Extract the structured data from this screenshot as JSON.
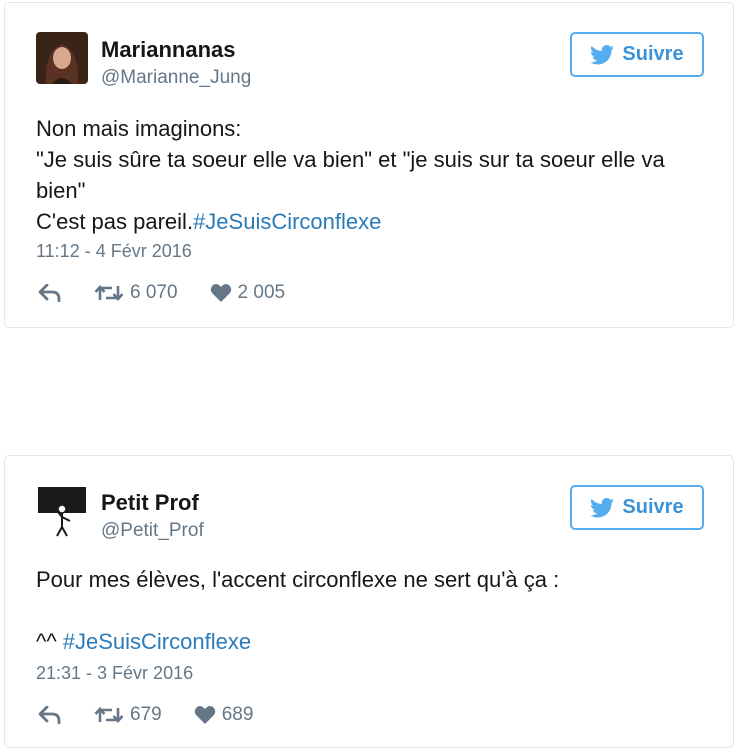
{
  "colors": {
    "accent": "#55acee",
    "link": "#2b7bb9",
    "muted": "#657786",
    "text": "#14171a",
    "border": "#e1e8ed"
  },
  "icons": {
    "follow": "twitter-bird-icon",
    "reply": "reply-arrow-icon",
    "retweet": "retweet-icon",
    "like": "heart-icon"
  },
  "tweets": [
    {
      "display_name": "Mariannanas",
      "handle": "@Marianne_Jung",
      "follow_label": "Suivre",
      "lines": [
        "Non mais imaginons:",
        "\"Je suis sûre ta soeur elle va bien\" et \"je suis sur ta soeur elle va",
        "bien\""
      ],
      "last_line_text": "C'est pas pareil.",
      "hashtag": "#JeSuisCirconflexe",
      "timestamp": "11:12 - 4 Févr 2016",
      "retweets": "6 070",
      "likes": "2 005"
    },
    {
      "display_name": "Petit Prof",
      "handle": "@Petit_Prof",
      "follow_label": "Suivre",
      "lines": [
        "Pour mes élèves, l'accent circonflexe ne sert qu'à ça :"
      ],
      "last_line_text": "^^ ",
      "hashtag": "#JeSuisCirconflexe",
      "timestamp": "21:31 - 3 Févr 2016",
      "retweets": "679",
      "likes": "689"
    }
  ]
}
